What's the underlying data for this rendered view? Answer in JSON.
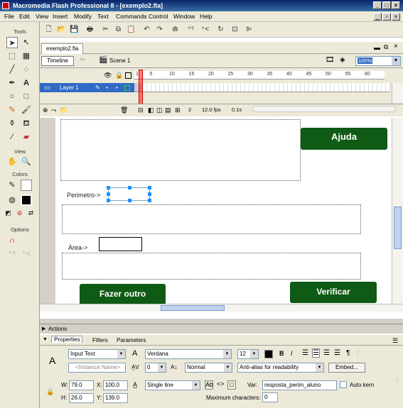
{
  "window": {
    "title": "Macromedia Flash Professional 8 - [exemplo2.fla]"
  },
  "menu": [
    "File",
    "Edit",
    "View",
    "Insert",
    "Modify",
    "Text",
    "Commands",
    "Control",
    "Window",
    "Help"
  ],
  "tools_panel": {
    "tools_label": "Tools",
    "view_label": "View",
    "colors_label": "Colors",
    "options_label": "Options"
  },
  "document": {
    "tab": "exemplo2.fla",
    "timeline_button": "Timeline",
    "scene": "Scene 1",
    "zoom": "100%"
  },
  "timeline": {
    "layer_name": "Layer 1",
    "ruler_ticks": [
      "1",
      "5",
      "10",
      "15",
      "20",
      "25",
      "30",
      "35",
      "40",
      "45",
      "50",
      "55",
      "60"
    ],
    "current_frame": "2",
    "fps": "12.0 fps",
    "time": "0.1s"
  },
  "stage": {
    "ajuda_label": "Ajuda",
    "perimetro_label": "Perimetro->",
    "area_label": "Área->",
    "fazer_outro_label": "Fazer outro",
    "verificar_label": "Verificar"
  },
  "actions_label": "Actions",
  "properties": {
    "tabs": [
      "Properties",
      "Filters",
      "Parameters"
    ],
    "text_type": "Input Text",
    "instance_placeholder": "<Instance Name>",
    "font": "Verdana",
    "font_size": "12",
    "letter_spacing": "0",
    "position": "Normal",
    "anti_alias": "Anti-alias for readability",
    "embed_label": "Embed...",
    "w": "79.0",
    "x": "100.0",
    "h": "26.0",
    "y": "139.0",
    "w_label": "W:",
    "x_label": "X:",
    "h_label": "H:",
    "y_label": "Y:",
    "line_type": "Single line",
    "var_label": "Var:",
    "var_value": "resposta_perim_aluno",
    "auto_kern": "Auto kern",
    "max_chars_label": "Maximum characters:",
    "max_chars": "0"
  }
}
